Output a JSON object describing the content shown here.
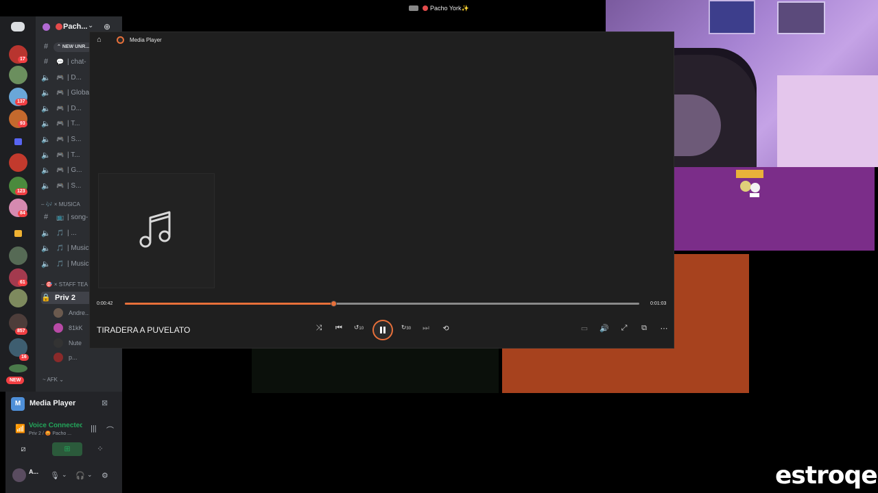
{
  "stream_title": "Pacho York✨",
  "server": {
    "name": "Pach...",
    "new_unreads": "NEW UNR..."
  },
  "rail_badges": [
    "17",
    "137",
    "93",
    "123",
    "84",
    "61",
    "857",
    "16"
  ],
  "rail_new": "NEW",
  "channels": [
    {
      "type": "text",
      "emoji": "💬",
      "label": "| chat-"
    },
    {
      "type": "voice",
      "emoji": "🎮",
      "label": "| D..."
    },
    {
      "type": "voice",
      "emoji": "🎮",
      "label": "| Globa"
    },
    {
      "type": "voice",
      "emoji": "🎮",
      "label": "| D..."
    },
    {
      "type": "voice",
      "emoji": "🎮",
      "label": "| T..."
    },
    {
      "type": "voice",
      "emoji": "🎮",
      "label": "| S..."
    },
    {
      "type": "voice",
      "emoji": "🎮",
      "label": "| T..."
    },
    {
      "type": "voice",
      "emoji": "🎮",
      "label": "| G..."
    },
    {
      "type": "voice",
      "emoji": "🎮",
      "label": "| S..."
    }
  ],
  "category_musica": "× MUSICA",
  "music_channels": [
    {
      "type": "text",
      "emoji": "📺",
      "label": "| song-"
    },
    {
      "type": "voice",
      "emoji": "🎵",
      "label": "| ..."
    },
    {
      "type": "voice",
      "emoji": "🎵",
      "label": "| Music"
    },
    {
      "type": "voice",
      "emoji": "🎵",
      "label": "| Music"
    }
  ],
  "category_staff": "× STAFF TEA",
  "active_channel": "Priv 2",
  "voice_members": [
    "Andre...",
    "81kK",
    "Nute",
    "p..."
  ],
  "category_afk": "AFK",
  "panel": {
    "activity_title": "Media Player",
    "voice_status": "Voice Connected",
    "voice_sub": "Priv 2 / 😡 Pacho ...",
    "user_name": "A..."
  },
  "player": {
    "window_title": "Media Player",
    "song_title": "TIRADERA A PUVELATO",
    "current_time": "0:00:42",
    "total_time": "0:01:03",
    "progress": 0.405,
    "accent": "#e8703a",
    "controls": [
      "shuffle-icon",
      "previous-icon",
      "rewind-10-icon",
      "pause-icon",
      "forward-30-icon",
      "next-icon",
      "repeat-off-icon"
    ],
    "right_controls": [
      "miniplayer-icon",
      "volume-icon",
      "fullscreen-icon",
      "cast-icon",
      "more-icon"
    ],
    "rewind_label": "10",
    "forward_label": "30"
  },
  "watermark": "estroqes"
}
